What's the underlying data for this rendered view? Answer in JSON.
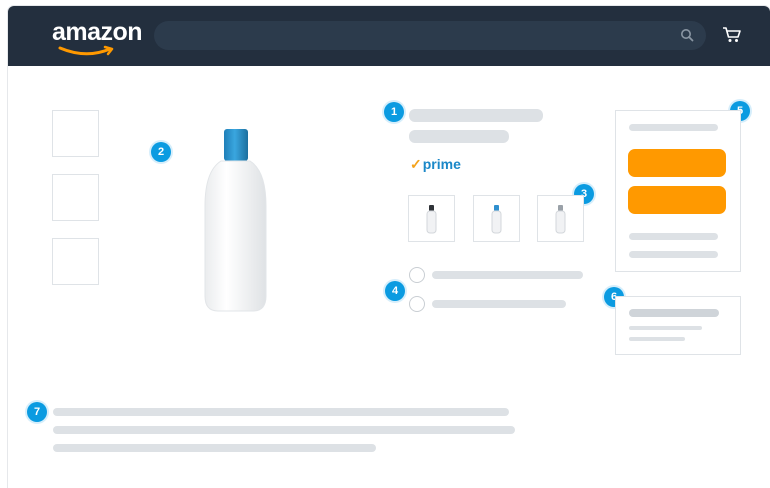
{
  "header": {
    "logo_text": "amazon",
    "logo_icon": "amazon-smile-icon",
    "search_icon": "search-icon",
    "cart_icon": "cart-icon",
    "colors": {
      "header_bg": "#232f3e",
      "search_bg": "#2c3b4c"
    }
  },
  "prime": {
    "check": "✓",
    "label": "prime"
  },
  "callouts": [
    "1",
    "2",
    "3",
    "4",
    "5",
    "6",
    "7"
  ],
  "colors": {
    "accent": "#0b9be1",
    "buy_button": "#ff9900",
    "placeholder": "#dde1e5"
  }
}
